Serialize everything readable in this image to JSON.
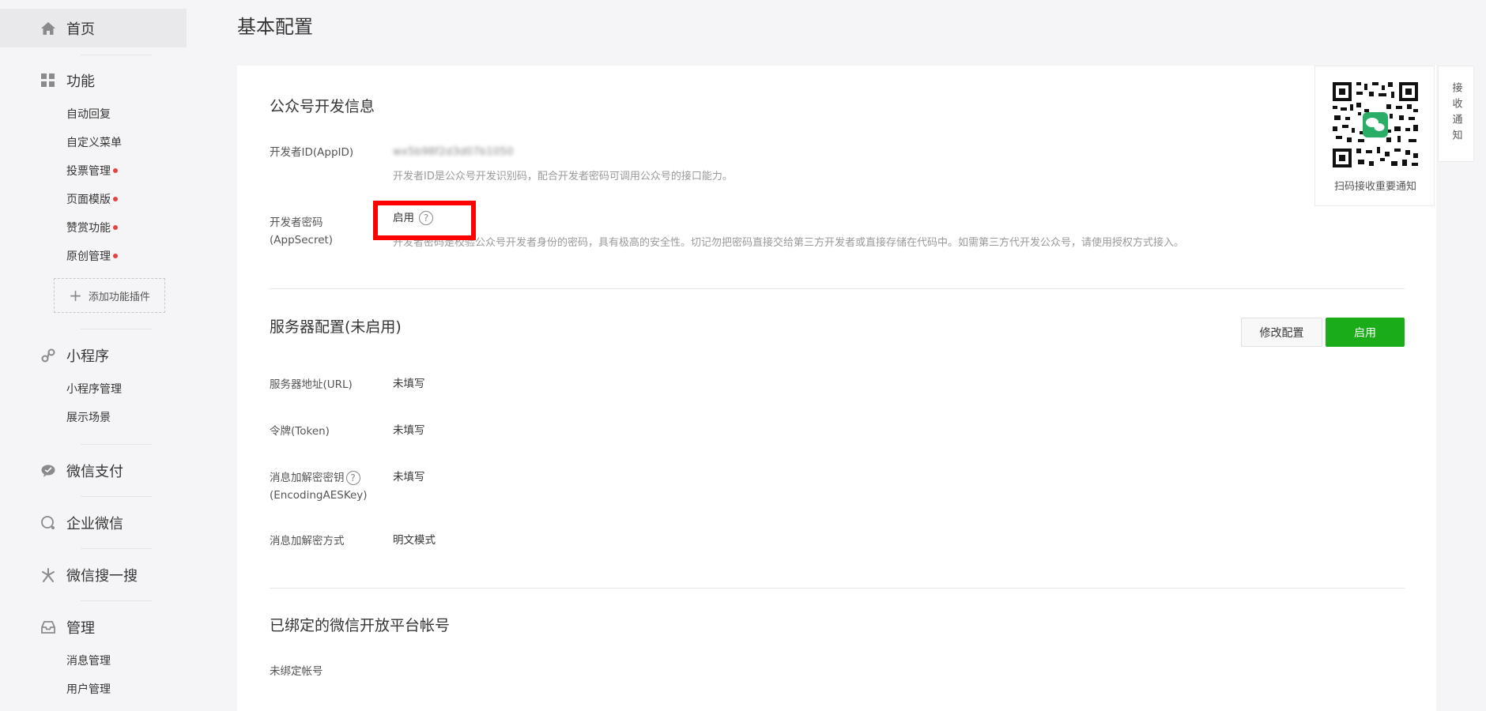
{
  "sidebar": {
    "home": "首页",
    "func": {
      "label": "功能",
      "items": [
        "自动回复",
        "自定义菜单",
        "投票管理",
        "页面模版",
        "赞赏功能",
        "原创管理"
      ],
      "add_plugin": "添加功能插件"
    },
    "mini": {
      "label": "小程序",
      "items": [
        "小程序管理",
        "展示场景"
      ]
    },
    "pay": "微信支付",
    "work": "企业微信",
    "search": "微信搜一搜",
    "manage": {
      "label": "管理",
      "items": [
        "消息管理",
        "用户管理"
      ]
    }
  },
  "page": {
    "title": "基本配置",
    "dev": {
      "title": "公众号开发信息",
      "appid_label": "开发者ID(AppID)",
      "appid_value": "wx5b98f2d3d07b1050",
      "appid_desc": "开发者ID是公众号开发识别码，配合开发者密码可调用公众号的接口能力。",
      "secret_label_1": "开发者密码",
      "secret_label_2": "(AppSecret)",
      "secret_value": "启用",
      "secret_help": "?",
      "secret_desc": "开发者密码是校验公众号开发者身份的密码，具有极高的安全性。切记勿把密码直接交给第三方开发者或直接存储在代码中。如需第三方代开发公众号，请使用授权方式接入。"
    },
    "server": {
      "title": "服务器配置(未启用)",
      "btn_modify": "修改配置",
      "btn_enable": "启用",
      "url_label": "服务器地址(URL)",
      "url_value": "未填写",
      "token_label": "令牌(Token)",
      "token_value": "未填写",
      "aes_label_1": "消息加解密密钥",
      "aes_help": "?",
      "aes_label_2": "(EncodingAESKey)",
      "aes_value": "未填写",
      "mode_label": "消息加解密方式",
      "mode_value": "明文模式"
    },
    "open": {
      "title": "已绑定的微信开放平台帐号",
      "label": "未绑定帐号"
    }
  },
  "qr": {
    "text": "扫码接收重要通知"
  },
  "side_tab": "接收通知",
  "colors": {
    "primary": "#1aad19",
    "highlight": "#ff0000",
    "dot": "#e64340"
  }
}
